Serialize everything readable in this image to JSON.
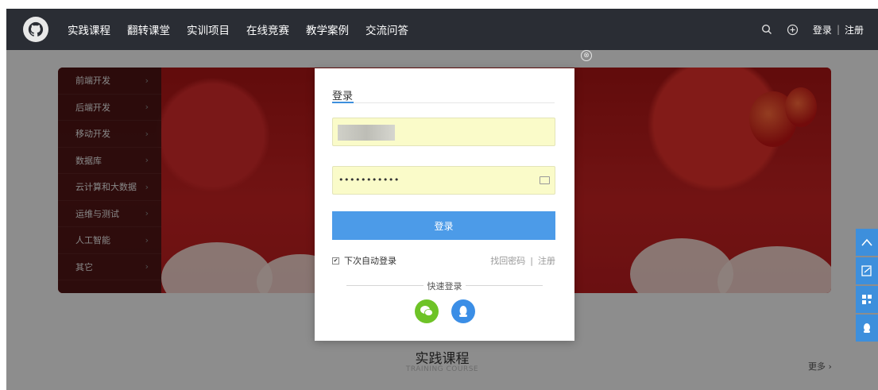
{
  "nav": {
    "items": [
      "实践课程",
      "翻转课堂",
      "实训项目",
      "在线竞赛",
      "教学案例",
      "交流问答"
    ],
    "login": "登录",
    "separator": "|",
    "register": "注册",
    "icons": [
      "github-logo-icon",
      "search-icon",
      "plus-circle-icon"
    ]
  },
  "sidebar": {
    "items": [
      {
        "label": "前端开发"
      },
      {
        "label": "后端开发"
      },
      {
        "label": "移动开发"
      },
      {
        "label": "数据库"
      },
      {
        "label": "云计算和大数据"
      },
      {
        "label": "运维与测试"
      },
      {
        "label": "人工智能"
      },
      {
        "label": "其它"
      }
    ],
    "chevron": "›"
  },
  "section": {
    "title": "实践课程",
    "subtitle": "TRAINING COURSE",
    "more": "更多 ›"
  },
  "modal": {
    "title": "登录",
    "password_mask": "•••••••••••",
    "login_button": "登录",
    "remember_label": "下次自动登录",
    "remember_checked": true,
    "forgot": "找回密码",
    "link_separator": "|",
    "register": "注册",
    "quick_login": "快速登录",
    "close_icon": "⊗"
  },
  "colors": {
    "nav_bg": "#2a2d34",
    "accent": "#4c9be8",
    "input_autofill": "#fafbc9",
    "wechat": "#6ec327",
    "qq": "#3b8ee6"
  },
  "side_tools": [
    "up-arrow-icon",
    "edit-icon",
    "qrcode-icon",
    "qq-icon"
  ]
}
